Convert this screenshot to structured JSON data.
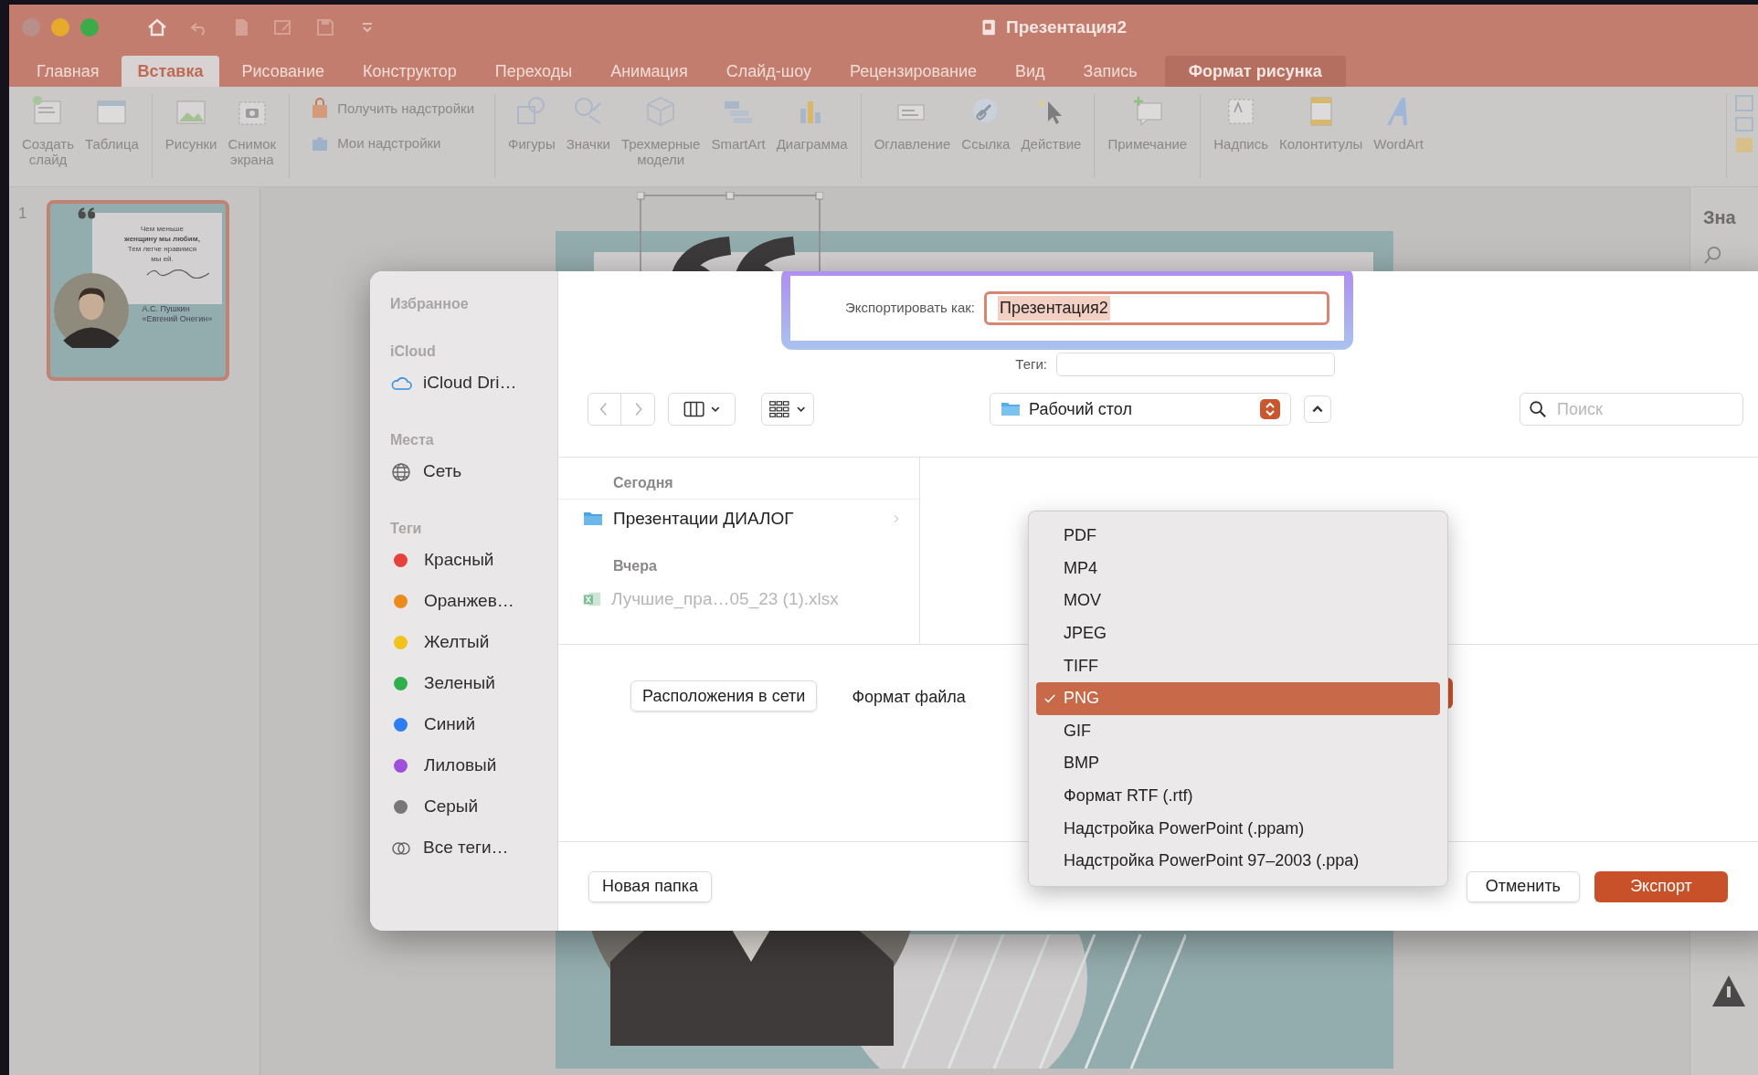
{
  "window": {
    "title": "Презентация2"
  },
  "ribbon_tabs": [
    {
      "label": "Главная",
      "selected": false,
      "kind": "normal"
    },
    {
      "label": "Вставка",
      "selected": true,
      "kind": "normal"
    },
    {
      "label": "Рисование",
      "selected": false,
      "kind": "normal"
    },
    {
      "label": "Конструктор",
      "selected": false,
      "kind": "normal"
    },
    {
      "label": "Переходы",
      "selected": false,
      "kind": "normal"
    },
    {
      "label": "Анимация",
      "selected": false,
      "kind": "normal"
    },
    {
      "label": "Слайд-шоу",
      "selected": false,
      "kind": "normal"
    },
    {
      "label": "Рецензирование",
      "selected": false,
      "kind": "normal"
    },
    {
      "label": "Вид",
      "selected": false,
      "kind": "normal"
    },
    {
      "label": "Запись",
      "selected": false,
      "kind": "normal"
    },
    {
      "label": "Формат рисунка",
      "selected": false,
      "kind": "contextual"
    }
  ],
  "ribbon_groups": [
    {
      "kind": "large",
      "buttons": [
        {
          "label": "Создать\nслайд"
        },
        {
          "label": "Таблица"
        }
      ]
    },
    {
      "kind": "large",
      "buttons": [
        {
          "label": "Рисунки"
        },
        {
          "label": "Снимок\nэкрана"
        }
      ]
    },
    {
      "kind": "small",
      "buttons": [
        {
          "label": "Получить надстройки"
        },
        {
          "label": "Мои надстройки"
        }
      ]
    },
    {
      "kind": "large",
      "buttons": [
        {
          "label": "Фигуры"
        },
        {
          "label": "Значки"
        },
        {
          "label": "Трехмерные\nмодели"
        },
        {
          "label": "SmartArt"
        },
        {
          "label": "Диаграмма"
        }
      ]
    },
    {
      "kind": "large",
      "buttons": [
        {
          "label": "Оглавление"
        },
        {
          "label": "Ссылка"
        },
        {
          "label": "Действие"
        }
      ]
    },
    {
      "kind": "large",
      "buttons": [
        {
          "label": "Примечание"
        }
      ]
    },
    {
      "kind": "large",
      "buttons": [
        {
          "label": "Надпись"
        },
        {
          "label": "Колонтитулы"
        },
        {
          "label": "WordArt"
        }
      ]
    }
  ],
  "slide_panel": {
    "slide_number": "1",
    "thumbnail": {
      "quote": "Чем меньше\n**женщину мы любим,**\nТем легче нравимся\nмы ей.",
      "author": "А.С. Пушкин\n«Евгений Онегин»"
    }
  },
  "side_pane": {
    "title": "Зна"
  },
  "dialog": {
    "sidebar": [
      {
        "heading": "Избранное"
      },
      {
        "heading": "iCloud",
        "items": [
          {
            "label": "iCloud Dri…",
            "kind": "cloud"
          }
        ]
      },
      {
        "heading": "Места",
        "items": [
          {
            "label": "Сеть",
            "kind": "globe"
          }
        ]
      },
      {
        "heading": "Теги",
        "items": [
          {
            "label": "Красный",
            "kind": "tag",
            "color": "#e8403a"
          },
          {
            "label": "Оранжев…",
            "kind": "tag",
            "color": "#ec8a1c"
          },
          {
            "label": "Желтый",
            "kind": "tag",
            "color": "#f2c21b"
          },
          {
            "label": "Зеленый",
            "kind": "tag",
            "color": "#30b04a"
          },
          {
            "label": "Синий",
            "kind": "tag",
            "color": "#2d7ef0"
          },
          {
            "label": "Лиловый",
            "kind": "tag",
            "color": "#a050d8"
          },
          {
            "label": "Серый",
            "kind": "tag",
            "color": "#777777"
          },
          {
            "label": "Все теги…",
            "kind": "all-tags"
          }
        ]
      }
    ],
    "export_label": "Экспортировать как:",
    "file_name": "Презентация2",
    "tags_label": "Теги:",
    "location": "Рабочий стол",
    "search_placeholder": "Поиск",
    "files": [
      {
        "heading": "Сегодня",
        "items": [
          {
            "label": "Презентации ДИАЛОГ",
            "kind": "folder",
            "disabled": false
          }
        ]
      },
      {
        "heading": "Вчера",
        "items": [
          {
            "label": "Лучшие_пра…05_23 (1).xlsx",
            "kind": "spreadsheet",
            "disabled": true
          }
        ]
      }
    ],
    "network_button": "Расположения в сети",
    "format_label": "Формат файла",
    "format_menu": [
      {
        "label": "PDF",
        "selected": false
      },
      {
        "label": "MP4",
        "selected": false
      },
      {
        "label": "MOV",
        "selected": false
      },
      {
        "label": "JPEG",
        "selected": false
      },
      {
        "label": "TIFF",
        "selected": false
      },
      {
        "label": "PNG",
        "selected": true
      },
      {
        "label": "GIF",
        "selected": false
      },
      {
        "label": "BMP",
        "selected": false
      },
      {
        "label": "Формат RTF (.rtf)",
        "selected": false
      },
      {
        "label": "Надстройка PowerPoint (.ppam)",
        "selected": false
      },
      {
        "label": "Надстройка PowerPoint 97–2003 (.ppa)",
        "selected": false
      }
    ],
    "new_folder_button": "Новая папка",
    "cancel_button": "Отменить",
    "export_button": "Экспорт"
  }
}
